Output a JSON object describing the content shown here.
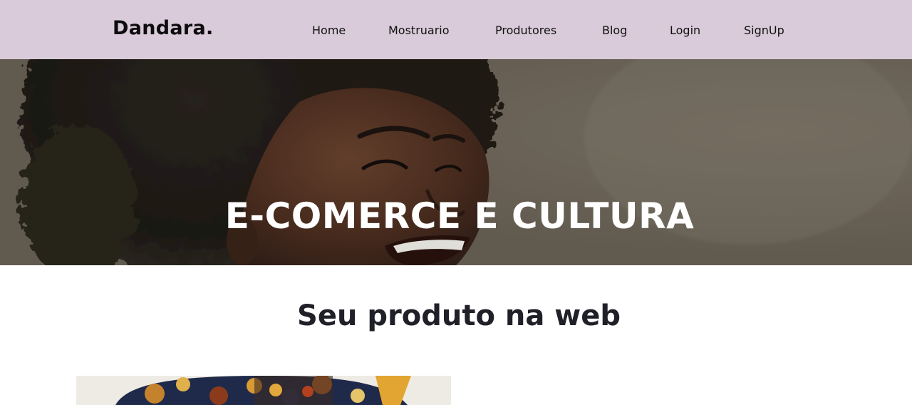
{
  "navbar": {
    "brand": "Dandara.",
    "links": [
      {
        "label": "Home"
      },
      {
        "label": "Mostruario"
      },
      {
        "label": "Produtores"
      },
      {
        "label": "Blog"
      },
      {
        "label": "Login"
      },
      {
        "label": "SignUp"
      }
    ],
    "background_color": "#d9cbd9"
  },
  "hero": {
    "title": "E-COMERCE E CULTURA",
    "image": "hero-photo-smiling-woman-curly-hair"
  },
  "main": {
    "section_title": "Seu produto na web",
    "product_image": "product-photo-patterned-headwrap"
  }
}
